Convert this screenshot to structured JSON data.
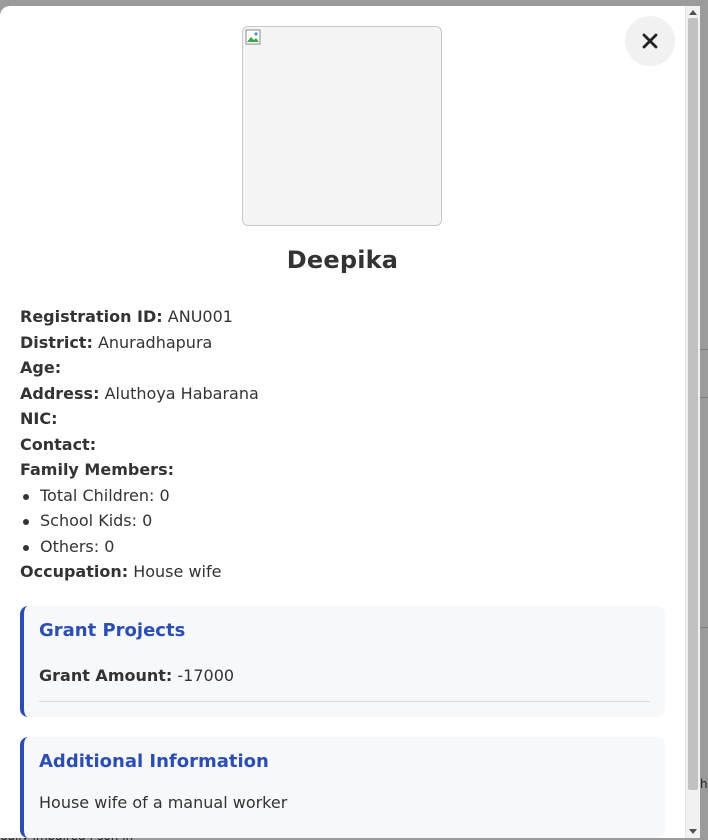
{
  "profile": {
    "name": "Deepika",
    "photo_icon": "broken-image-icon"
  },
  "close_icon": "close-icon",
  "details": {
    "registration_id_label": "Registration ID:",
    "registration_id_value": "ANU001",
    "district_label": "District:",
    "district_value": "Anuradhapura",
    "age_label": "Age:",
    "age_value": "",
    "address_label": "Address:",
    "address_value": "Aluthoya Habarana",
    "nic_label": "NIC:",
    "nic_value": "",
    "contact_label": "Contact:",
    "contact_value": "",
    "family_label": "Family Members:",
    "family": [
      {
        "label": "Total Children:",
        "value": "0"
      },
      {
        "label": "School Kids:",
        "value": "0"
      },
      {
        "label": "Others:",
        "value": "0"
      }
    ],
    "occupation_label": "Occupation:",
    "occupation_value": "House wife"
  },
  "grant": {
    "title": "Grant Projects",
    "amount_label": "Grant Amount:",
    "amount_value": "-17000"
  },
  "additional": {
    "title": "Additional Information",
    "text": "House wife of a manual worker"
  },
  "background": {
    "bottom_text": "ually impaired | son in",
    "right_text": "he"
  },
  "colors": {
    "accent": "#2c4eb3",
    "panel_bg": "#f7f8fa",
    "text": "#333333"
  }
}
